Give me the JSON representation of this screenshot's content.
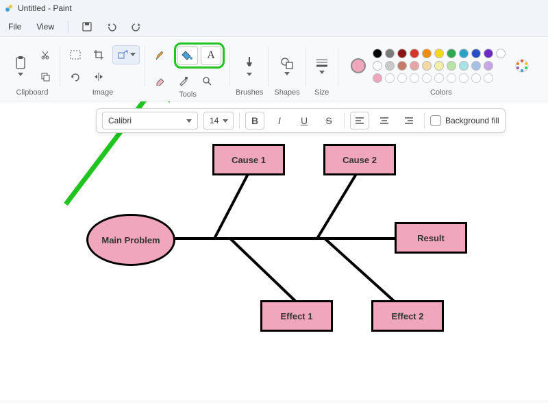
{
  "app": {
    "title": "Untitled - Paint"
  },
  "menu": {
    "file": "File",
    "view": "View"
  },
  "ribbon": {
    "clipboard": {
      "label": "Clipboard"
    },
    "image": {
      "label": "Image"
    },
    "tools": {
      "label": "Tools"
    },
    "brushes": {
      "label": "Brushes"
    },
    "shapes": {
      "label": "Shapes"
    },
    "size": {
      "label": "Size"
    },
    "colors": {
      "label": "Colors"
    }
  },
  "text_toolbar": {
    "font": "Calibri",
    "size": "14",
    "bold": "B",
    "italic": "I",
    "underline": "U",
    "strike": "S",
    "bg_fill": "Background fill"
  },
  "palette": {
    "selected": "#f0a6bd",
    "row1": [
      "#000000",
      "#7a7a7a",
      "#8a1616",
      "#d9342b",
      "#f08c00",
      "#f2d81a",
      "#2fa84f",
      "#2aa3c7",
      "#2a4ec7",
      "#6a2ac7",
      "#ffffff"
    ],
    "row2": [
      "#ffffff",
      "#c9c9c9",
      "#c47b6a",
      "#e7a6a6",
      "#f2d9a6",
      "#f2efa6",
      "#b7e3a6",
      "#a6e3e7",
      "#a6bfe7",
      "#c7a6e7"
    ]
  },
  "diagram": {
    "main": "Main Problem",
    "cause1": "Cause 1",
    "cause2": "Cause 2",
    "result": "Result",
    "effect1": "Effect 1",
    "effect2": "Effect 2"
  }
}
